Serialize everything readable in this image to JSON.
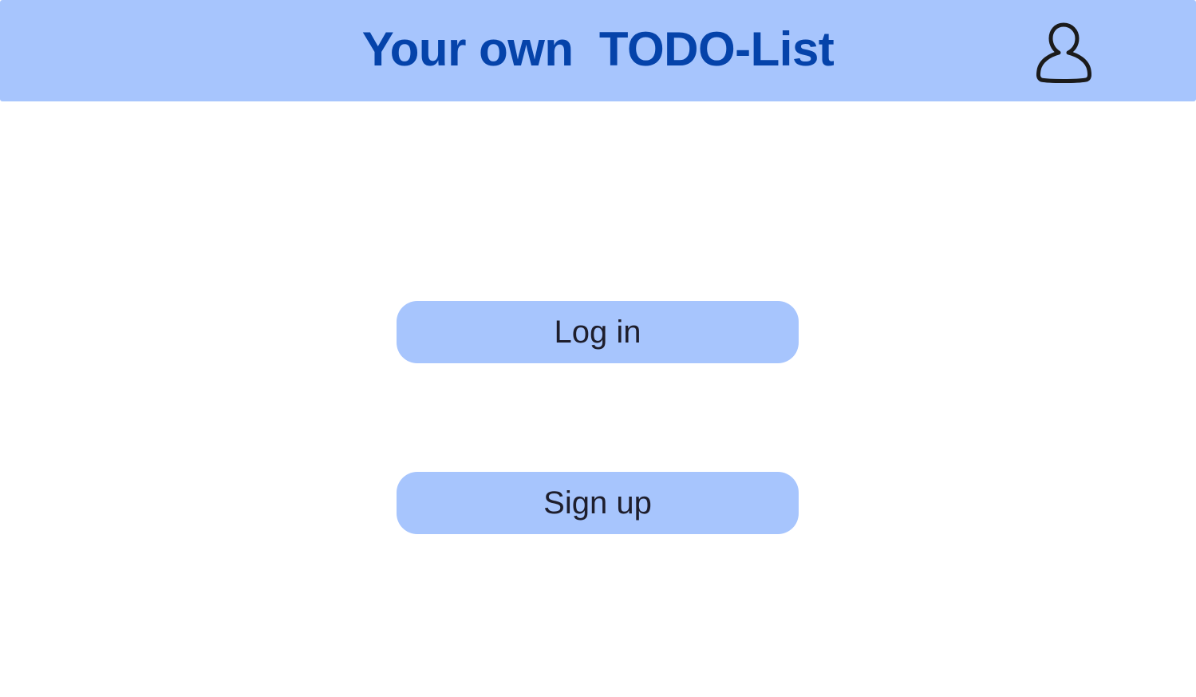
{
  "header": {
    "title": "Your own  TODO-List",
    "background_color": "#a7c5fd",
    "title_color": "#0543aa",
    "user_icon": "user-profile-icon"
  },
  "main": {
    "login_label": "Log in",
    "signup_label": "Sign up",
    "button_color": "#a7c5fd"
  }
}
